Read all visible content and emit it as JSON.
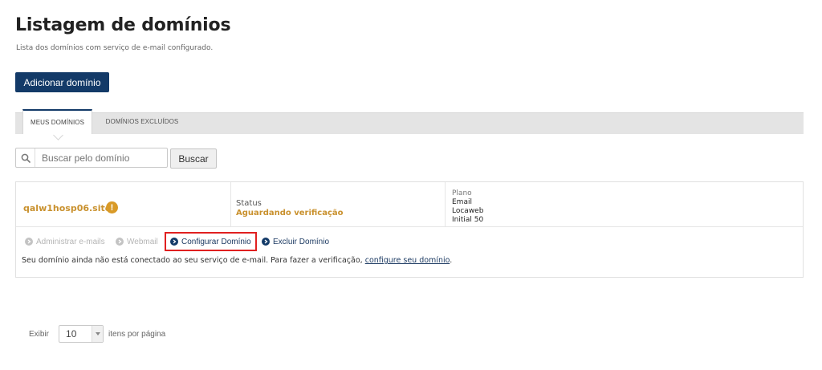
{
  "header": {
    "title": "Listagem de domínios",
    "subtitle": "Lista dos domínios com serviço de e-mail configurado."
  },
  "actions": {
    "add_domain": "Adicionar domínio"
  },
  "tabs": [
    {
      "label": "MEUS DOMÍNIOS",
      "active": true
    },
    {
      "label": "DOMÍNIOS EXCLUÍDOS",
      "active": false
    }
  ],
  "search": {
    "placeholder": "Buscar pelo domínio",
    "value": "",
    "button_label": "Buscar"
  },
  "domain": {
    "name": "qalw1hosp06.site",
    "warning_icon_text": "!",
    "status_label": "Status",
    "status_value": "Aguardando verificação",
    "plan_label": "Plano",
    "plan_lines": [
      "Email",
      "Locaweb",
      "Initial 50"
    ],
    "actions": [
      {
        "label": "Administrar e-mails",
        "enabled": false
      },
      {
        "label": "Webmail",
        "enabled": false
      },
      {
        "label": "Configurar Domínio",
        "enabled": true,
        "highlighted": true
      },
      {
        "label": "Excluir Domínio",
        "enabled": true
      }
    ],
    "notice_text": "Seu domínio ainda não está conectado ao seu serviço de e-mail. Para fazer a verificação,",
    "notice_link": "configure seu domínio",
    "notice_end": "."
  },
  "pagination": {
    "before_label": "Exibir",
    "per_page_value": "10",
    "after_label": "itens por página"
  },
  "colors": {
    "brand": "#133a68",
    "warning": "#c9912e",
    "highlight_border": "#e02020"
  }
}
